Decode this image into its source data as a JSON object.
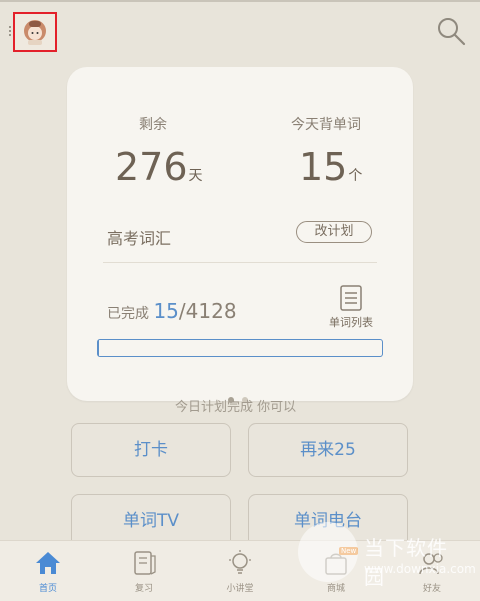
{
  "header": {
    "avatar_icon": "avatar-icon",
    "search_icon": "search-icon"
  },
  "card": {
    "remaining_label": "剩余",
    "remaining_value": "276",
    "remaining_unit": "天",
    "today_label": "今天背单词",
    "today_value": "15",
    "today_unit": "个",
    "book_name": "高考词汇",
    "change_plan_label": "改计划",
    "completed_label": "已完成",
    "completed_count": "15",
    "completed_total": "/4128",
    "word_list_label": "单词列表",
    "progress_fraction": 0.0036,
    "page_dots": 2,
    "active_page": 0
  },
  "under_card_text": "今日计划完成 你可以",
  "buttons": {
    "checkin": "打卡",
    "again": "再来25",
    "word_tv": "单词TV",
    "word_radio": "单词电台"
  },
  "tabbar": [
    {
      "label": "首页",
      "icon": "home-icon"
    },
    {
      "label": "复习",
      "icon": "review-icon"
    },
    {
      "label": "小讲堂",
      "icon": "lightbulb-icon"
    },
    {
      "label": "商城",
      "icon": "store-icon",
      "badge": "New"
    },
    {
      "label": "好友",
      "icon": "friends-icon"
    }
  ],
  "watermark": {
    "title": "当下软件园",
    "url": "www.downxia.com"
  },
  "colors": {
    "accent": "#5b8fc9",
    "background": "#e8e4da",
    "card": "#f7f5f0"
  }
}
